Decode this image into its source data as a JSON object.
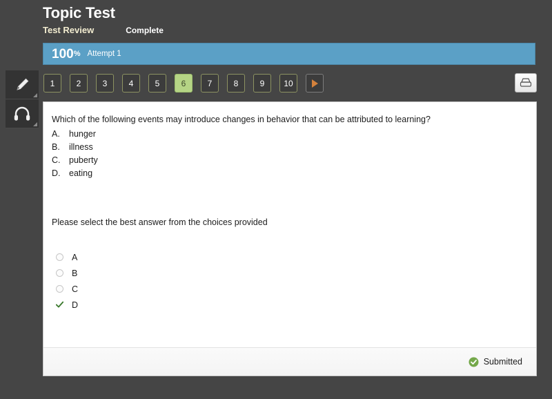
{
  "header": {
    "title": "Topic Test",
    "subtitle": "Test Review",
    "status": "Complete"
  },
  "score": {
    "percent": "100",
    "percent_symbol": "%",
    "attempt": "Attempt 1",
    "bar_color": "#5ba0c6"
  },
  "rail": {
    "items": [
      {
        "icon": "pencil-icon",
        "name": "highlighter-tool"
      },
      {
        "icon": "headphones-icon",
        "name": "audio-tool"
      }
    ]
  },
  "qnav": {
    "buttons": [
      "1",
      "2",
      "3",
      "4",
      "5",
      "6",
      "7",
      "8",
      "9",
      "10"
    ],
    "active_index": 5,
    "next_label": "next-arrow",
    "active_color": "#b5d485",
    "border_color": "#8d9362"
  },
  "toolbar": {
    "print_label": "print-icon"
  },
  "question": {
    "stem": "Which of the following events may introduce changes in behavior that can be attributed to learning?",
    "choices": [
      {
        "label": "A.",
        "text": "hunger"
      },
      {
        "label": "B.",
        "text": "illness"
      },
      {
        "label": "C.",
        "text": "puberty"
      },
      {
        "label": "D.",
        "text": "eating"
      }
    ],
    "prompt": "Please select the best answer from the choices provided"
  },
  "answers": {
    "options": [
      {
        "value": "A",
        "selected": false
      },
      {
        "value": "B",
        "selected": false
      },
      {
        "value": "C",
        "selected": false
      },
      {
        "value": "D",
        "selected": true
      }
    ],
    "correct_color": "#3c7a2e"
  },
  "footer": {
    "status": "Submitted",
    "status_color": "#74a84a"
  }
}
